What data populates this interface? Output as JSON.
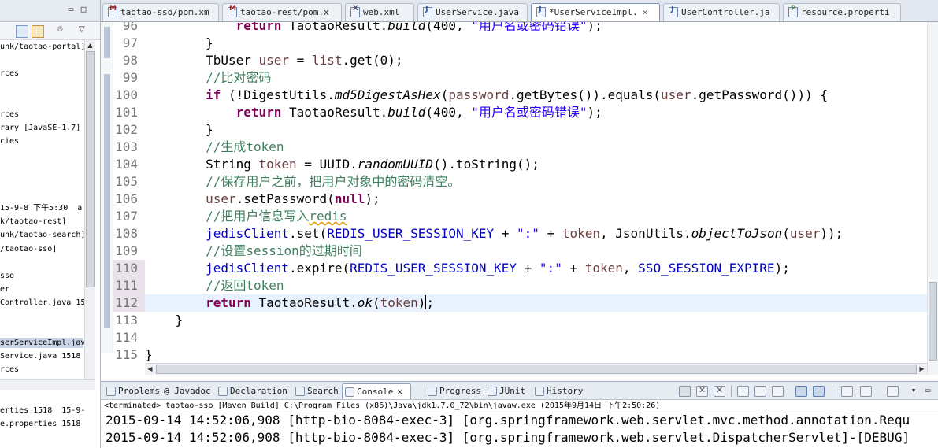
{
  "explorer": {
    "lines": [
      {
        "text": "unk/taotao-portal]",
        "sel": false
      },
      {
        "text": "",
        "sel": false
      },
      {
        "text": "rces",
        "sel": false
      },
      {
        "text": "",
        "sel": false
      },
      {
        "text": "",
        "sel": false
      },
      {
        "text": "rces",
        "sel": false
      },
      {
        "text": "rary [JavaSE-1.7]",
        "sel": false
      },
      {
        "text": "cies",
        "sel": false
      },
      {
        "text": "",
        "sel": false
      },
      {
        "text": "",
        "sel": false
      },
      {
        "text": "",
        "sel": false
      },
      {
        "text": "",
        "sel": false
      },
      {
        "text": "15-9-8 下午5:30  a",
        "sel": false
      },
      {
        "text": "k/taotao-rest]",
        "sel": false
      },
      {
        "text": "unk/taotao-search]",
        "sel": false
      },
      {
        "text": "/taotao-sso]",
        "sel": false
      },
      {
        "text": "",
        "sel": false
      },
      {
        "text": "sso",
        "sel": false
      },
      {
        "text": "er",
        "sel": false
      },
      {
        "text": "Controller.java 15",
        "sel": false
      },
      {
        "text": "",
        "sel": false
      },
      {
        "text": "",
        "sel": false
      },
      {
        "text": "serServiceImpl.jav",
        "sel": true
      },
      {
        "text": "Service.java 1518",
        "sel": false
      },
      {
        "text": "rces",
        "sel": false
      },
      {
        "text": "",
        "sel": false
      },
      {
        "text": "",
        "sel": false
      },
      {
        "text": "erties 1518  15-9-",
        "sel": false
      },
      {
        "text": "e.properties 1518",
        "sel": false
      }
    ]
  },
  "tabs": [
    {
      "label": "taotao-sso/pom.xm",
      "icon": "m",
      "active": false
    },
    {
      "label": "taotao-rest/pom.x",
      "icon": "m",
      "active": false
    },
    {
      "label": "web.xml",
      "icon": "x",
      "active": false
    },
    {
      "label": "UserService.java",
      "icon": "j",
      "active": false
    },
    {
      "label": "*UserServiceImpl.",
      "icon": "j",
      "active": true,
      "close": "✕"
    },
    {
      "label": "UserController.ja",
      "icon": "j",
      "active": false
    },
    {
      "label": "resource.properti",
      "icon": "p",
      "active": false
    }
  ],
  "editor": {
    "line_numbers": [
      "96",
      "97",
      "98",
      "99",
      "100",
      "101",
      "102",
      "103",
      "104",
      "105",
      "106",
      "107",
      "108",
      "109",
      "110",
      "111",
      "112",
      "113",
      "114",
      "115"
    ],
    "modified_lines": [
      "110",
      "111",
      "112"
    ],
    "current_line": "112"
  },
  "console": {
    "tabs": [
      {
        "label": "Problems",
        "active": false
      },
      {
        "label": "@ Javadoc",
        "active": false
      },
      {
        "label": "Declaration",
        "active": false
      },
      {
        "label": "Search",
        "active": false
      },
      {
        "label": "Console",
        "active": true,
        "close": "✕"
      },
      {
        "label": "Progress",
        "active": false
      },
      {
        "label": "JUnit",
        "active": false
      },
      {
        "label": "History",
        "active": false
      }
    ],
    "header": "<terminated> taotao-sso [Maven Build] C:\\Program Files (x86)\\Java\\jdk1.7.0_72\\bin\\javaw.exe (2015年9月14日 下午2:50:26)",
    "lines": [
      "2015-09-14 14:52:06,908 [http-bio-8084-exec-3] [org.springframework.web.servlet.mvc.method.annotation.Requ",
      "2015-09-14 14:52:06,908 [http-bio-8084-exec-3] [org.springframework.web.servlet.DispatcherServlet]-[DEBUG]"
    ]
  },
  "colors": {
    "keyword": "#7f0055",
    "comment": "#3f7f5f",
    "string": "#2a00ff",
    "field": "#0000c0",
    "local_var": "#6a3e3e",
    "current_line_bg": "#e8f2fe"
  }
}
